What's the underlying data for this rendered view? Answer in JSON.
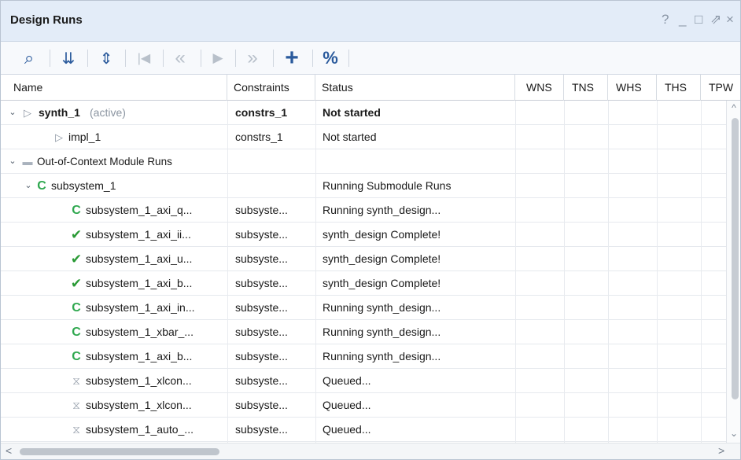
{
  "window": {
    "title": "Design Runs",
    "controls": [
      "?",
      "_",
      "□",
      "⇗",
      "×"
    ]
  },
  "toolbar": {
    "icons": [
      "search-icon",
      "collapse-all-icon",
      "expand-all-icon",
      "first-icon",
      "previous-icon",
      "play-icon",
      "next-icon",
      "add-icon",
      "percent-icon"
    ],
    "search": "⌕",
    "collapse": "⇊",
    "expand": "⇕",
    "first": "|◀",
    "previous": "«",
    "play": "▶",
    "next": "»",
    "add": "+",
    "percent": "%"
  },
  "columns": {
    "name": "Name",
    "constraints": "Constraints",
    "status": "Status",
    "wns": "WNS",
    "tns": "TNS",
    "whs": "WHS",
    "ths": "THS",
    "tpw": "TPW"
  },
  "rows": [
    {
      "name": "synth_1",
      "suffix": "(active)",
      "constraints": "constrs_1",
      "status": "Not started"
    },
    {
      "name": "impl_1",
      "constraints": "constrs_1",
      "status": "Not started"
    },
    {
      "name": "Out-of-Context Module Runs"
    },
    {
      "name": "subsystem_1",
      "constraints": "",
      "status": "Running Submodule Runs"
    },
    {
      "name": "subsystem_1_axi_q...",
      "constraints": "subsyste...",
      "status": "Running synth_design..."
    },
    {
      "name": "subsystem_1_axi_ii...",
      "constraints": "subsyste...",
      "status": "synth_design Complete!"
    },
    {
      "name": "subsystem_1_axi_u...",
      "constraints": "subsyste...",
      "status": "synth_design Complete!"
    },
    {
      "name": "subsystem_1_axi_b...",
      "constraints": "subsyste...",
      "status": "synth_design Complete!"
    },
    {
      "name": "subsystem_1_axi_in...",
      "constraints": "subsyste...",
      "status": "Running synth_design..."
    },
    {
      "name": "subsystem_1_xbar_...",
      "constraints": "subsyste...",
      "status": "Running synth_design..."
    },
    {
      "name": "subsystem_1_axi_b...",
      "constraints": "subsyste...",
      "status": "Running synth_design..."
    },
    {
      "name": "subsystem_1_xlcon...",
      "constraints": "subsyste...",
      "status": "Queued..."
    },
    {
      "name": "subsystem_1_xlcon...",
      "constraints": "subsyste...",
      "status": "Queued..."
    },
    {
      "name": "subsystem_1_auto_...",
      "constraints": "subsyste...",
      "status": "Queued..."
    }
  ],
  "colors": {
    "accent": "#2a5a9c",
    "running": "#2fa84f",
    "complete": "#2a9a35",
    "titlebar": "#e3ecf8"
  }
}
